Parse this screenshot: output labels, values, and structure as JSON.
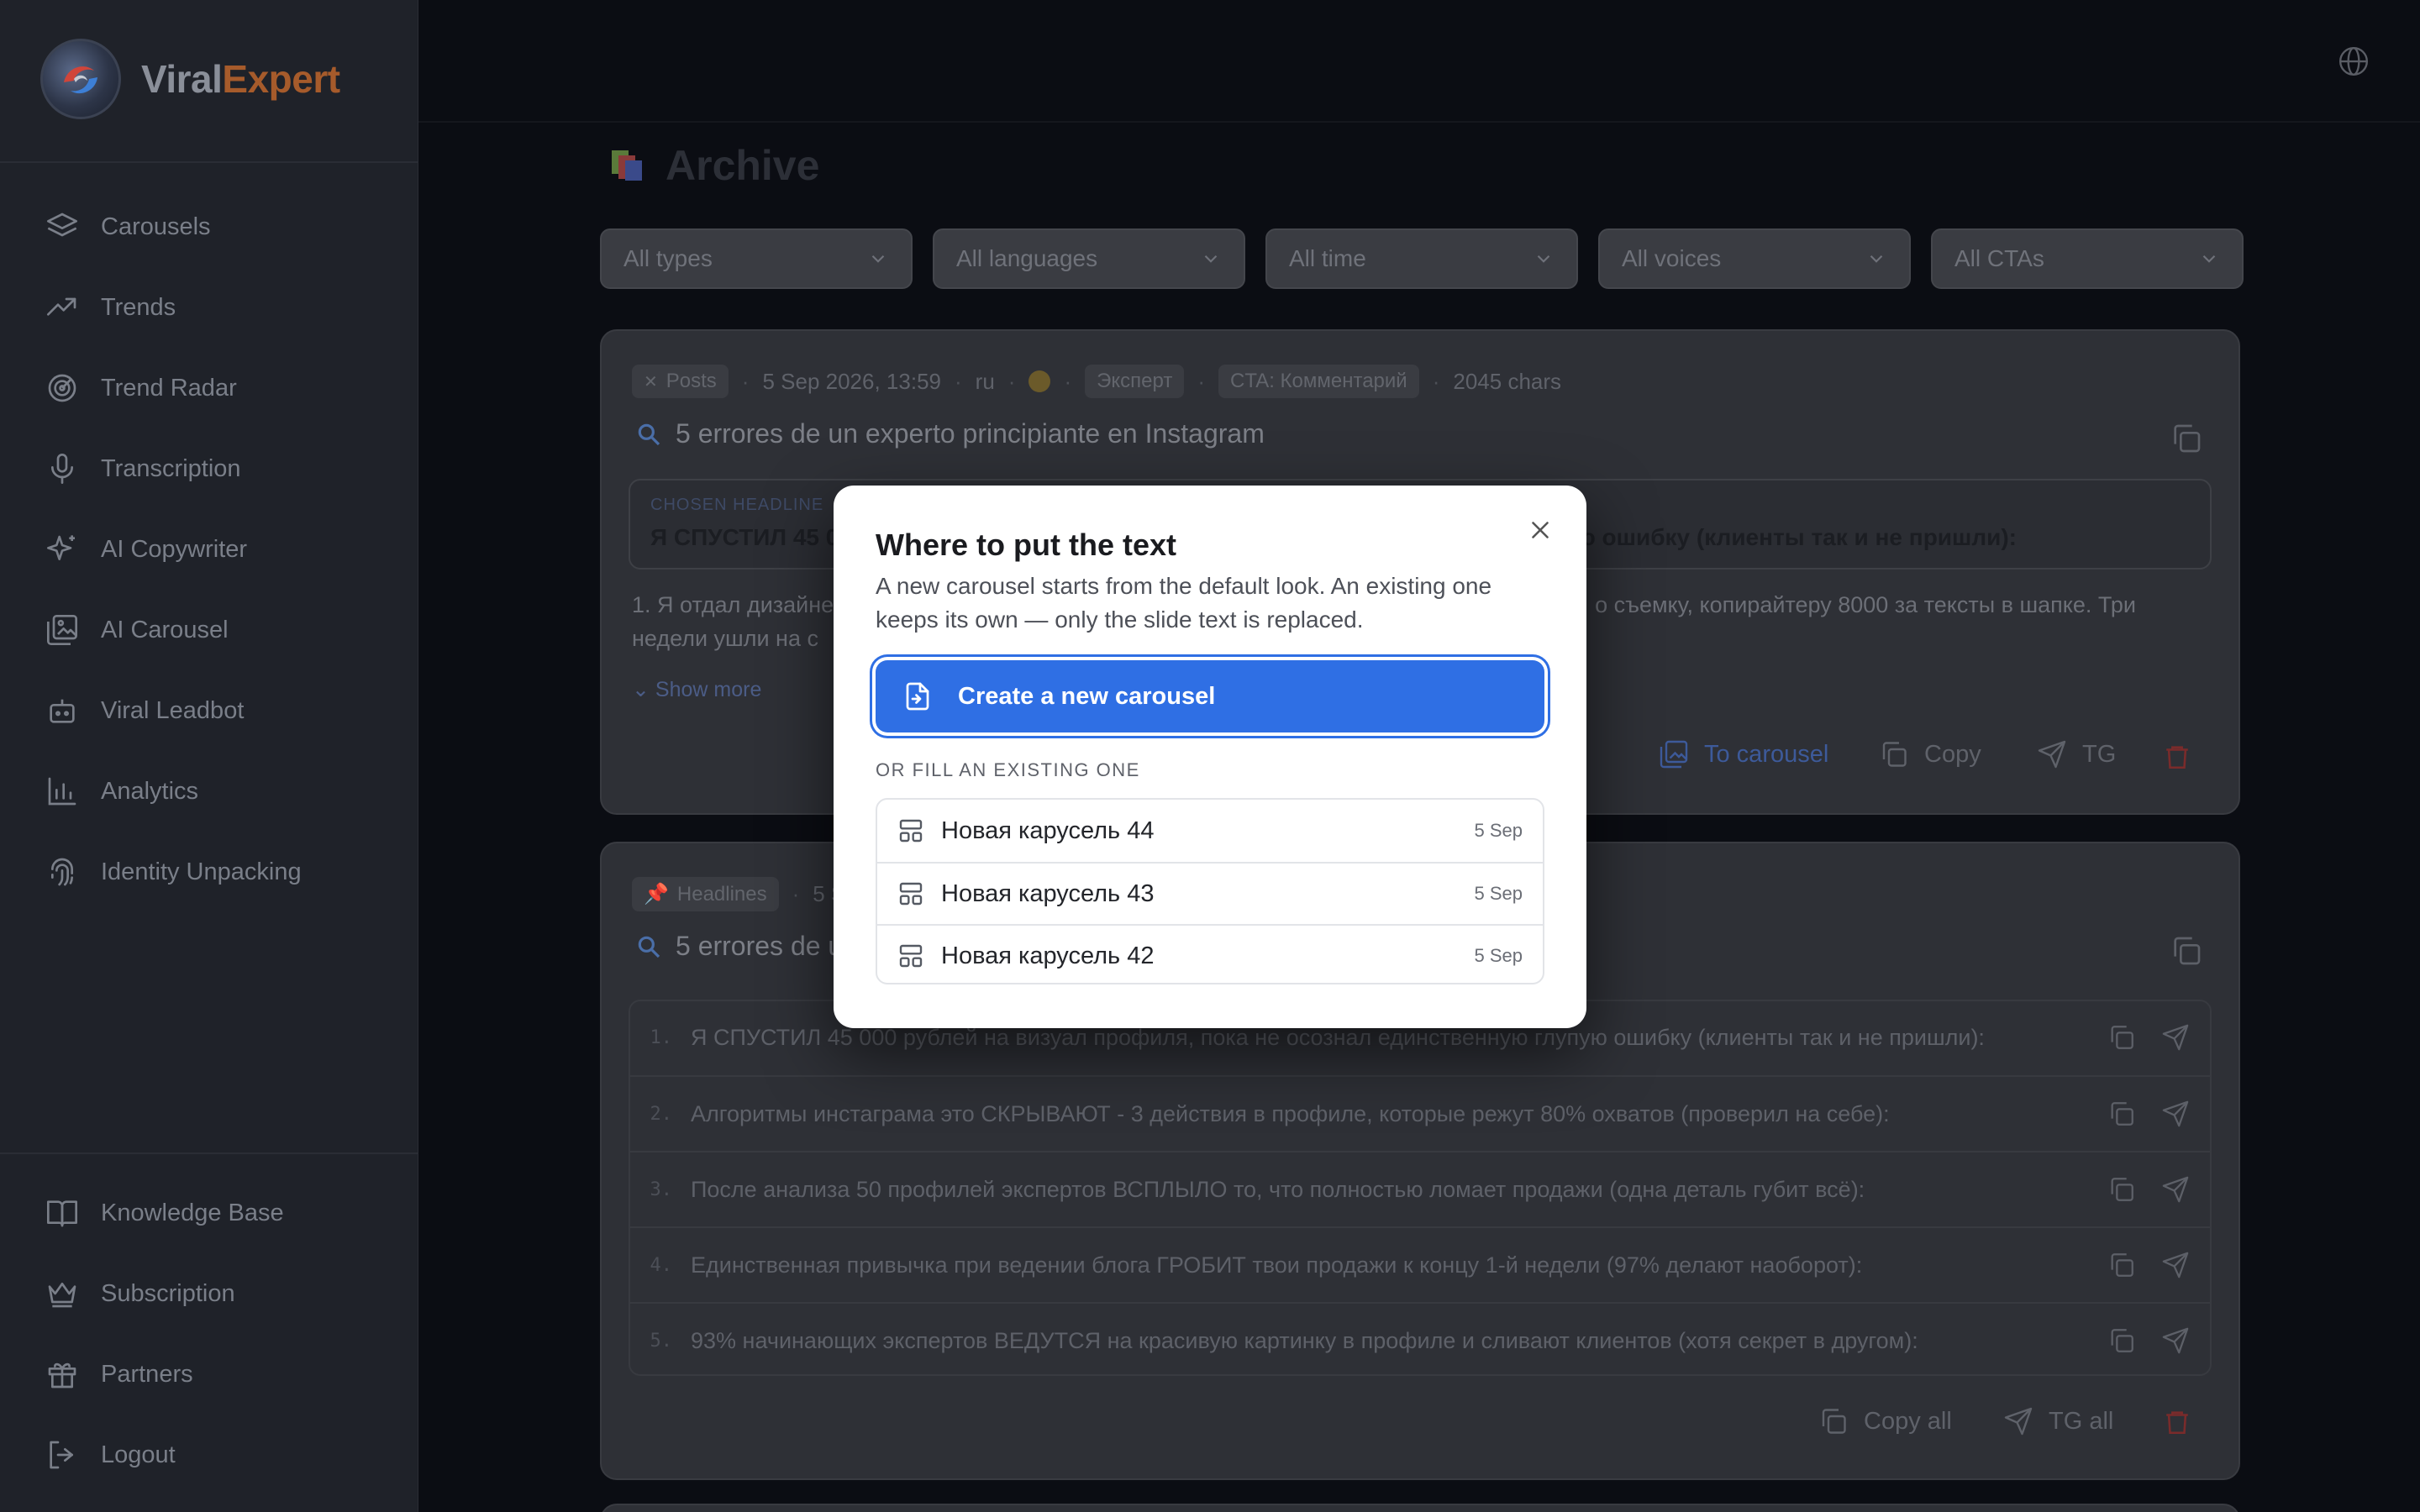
{
  "brand": {
    "part1": "Viral",
    "part2": "Expert"
  },
  "sidebar": {
    "items": [
      {
        "label": "Carousels",
        "icon": "layers-icon"
      },
      {
        "label": "Trends",
        "icon": "trending-up-icon"
      },
      {
        "label": "Trend Radar",
        "icon": "radar-icon"
      },
      {
        "label": "Transcription",
        "icon": "microphone-icon"
      },
      {
        "label": "AI Copywriter",
        "icon": "sparkles-icon"
      },
      {
        "label": "AI Carousel",
        "icon": "images-icon"
      },
      {
        "label": "Viral Leadbot",
        "icon": "bot-icon"
      },
      {
        "label": "Analytics",
        "icon": "bar-chart-icon"
      },
      {
        "label": "Identity Unpacking",
        "icon": "fingerprint-icon"
      }
    ],
    "bottom_items": [
      {
        "label": "Knowledge Base",
        "icon": "book-icon"
      },
      {
        "label": "Subscription",
        "icon": "crown-icon"
      },
      {
        "label": "Partners",
        "icon": "gift-icon"
      },
      {
        "label": "Logout",
        "icon": "logout-icon"
      }
    ]
  },
  "page": {
    "title": "Archive"
  },
  "filters": [
    "All types",
    "All languages",
    "All time",
    "All voices",
    "All CTAs"
  ],
  "card1": {
    "type_chip": "Posts",
    "date": "5 Sep 2026, 13:59",
    "lang": "ru",
    "voice_chip": "Эксперт",
    "cta_chip": "CTA: Комментарий",
    "chars": "2045 chars",
    "title": "5 errores de un experto principiante en Instagram",
    "chosen_label": "CHOSEN HEADLINE",
    "chosen_text_start": "Я СПУСТИЛ 45 0",
    "chosen_text_end": "ую ошибку (клиенты так и не пришли):",
    "body_line1_start": "1. Я отдал дизайнер",
    "body_line1_end": "о съемку, копирайтеру 8000 за тексты в шапке. Три",
    "body_line2": "недели ушли на с",
    "show_more": "Show more",
    "actions": {
      "to_carousel": "To carousel",
      "copy": "Copy",
      "tg": "TG"
    }
  },
  "card2": {
    "type_chip": "Headlines",
    "date_partial": "5 S",
    "title_partial": "5 errores de u",
    "headlines": [
      {
        "num": "1.",
        "text": "Я СПУСТИЛ 45 000 рублей на визуал профиля, пока не осознал единственную глупую ошибку (клиенты так и не пришли):"
      },
      {
        "num": "2.",
        "text": "Алгоритмы инстаграма это СКРЫВАЮТ - 3 действия в профиле, которые режут 80% охватов (проверил на себе):"
      },
      {
        "num": "3.",
        "text": "После анализа 50 профилей экспертов ВСПЛЫЛО то, что полностью ломает продажи (одна деталь губит всё):"
      },
      {
        "num": "4.",
        "text": "Единственная привычка при ведении блога ГРОБИТ твои продажи к концу 1-й недели (97% делают наоборот):"
      },
      {
        "num": "5.",
        "text": "93% начинающих экспертов ВЕДУТСЯ на красивую картинку в профиле и сливают клиентов (хотя секрет в другом):"
      }
    ],
    "actions": {
      "copy_all": "Copy all",
      "tg_all": "TG all"
    }
  },
  "modal": {
    "title": "Where to put the text",
    "description": "A new carousel starts from the default look. An existing one keeps its own — only the slide text is replaced.",
    "primary_label": "Create a new carousel",
    "or_label": "OR FILL AN EXISTING ONE",
    "existing": [
      {
        "name": "Новая карусель 44",
        "date": "5 Sep"
      },
      {
        "name": "Новая карусель 43",
        "date": "5 Sep"
      },
      {
        "name": "Новая карусель 42",
        "date": "5 Sep"
      }
    ]
  },
  "colors": {
    "accent": "#2f6fe4",
    "brand_orange": "#a65b2b",
    "danger": "#7a2b2b"
  }
}
